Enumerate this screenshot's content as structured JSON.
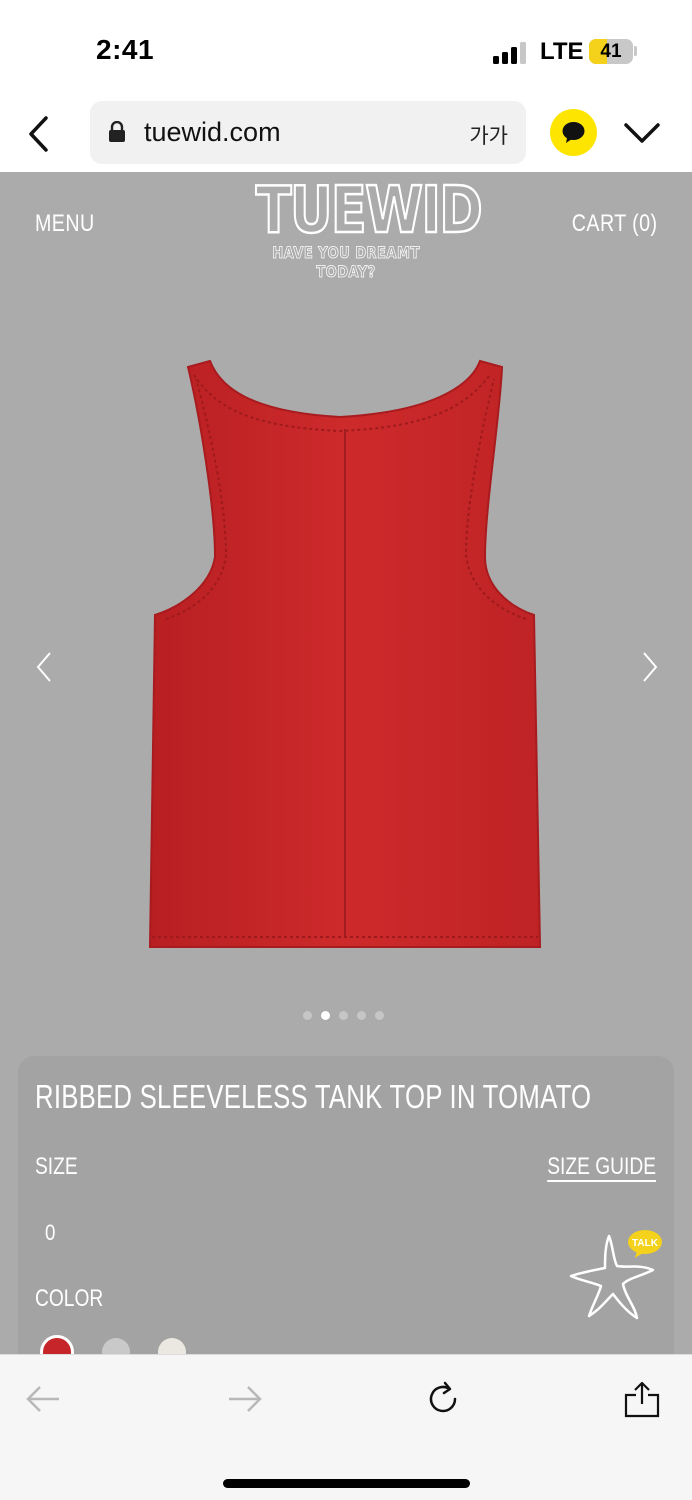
{
  "status_bar": {
    "time": "2:41",
    "network": "LTE",
    "battery_level": "41",
    "battery_fraction": 0.41,
    "signal_bars_active": 3,
    "signal_bars_total": 4
  },
  "browser": {
    "url": "tuewid.com",
    "font_size_button": "가가",
    "icons": {
      "back": "chevron-left-icon",
      "lock": "lock-icon",
      "kakao": "kakao-chat-icon",
      "more": "chevron-down-icon"
    }
  },
  "site_header": {
    "menu_label": "MENU",
    "cart_label": "CART (0)",
    "logo_text": "TUEWID",
    "logo_tagline": "HAVE YOU DREAMT TODAY?"
  },
  "gallery": {
    "image_alt": "red ribbed sleeveless tank top",
    "slide_count": 5,
    "active_slide": 2
  },
  "product": {
    "title": "RIBBED SLEEVELESS TANK TOP IN TOMATO",
    "size_label": "SIZE",
    "size_guide_label": "SIZE GUIDE",
    "size_options": [
      "0"
    ],
    "color_label": "COLOR",
    "color_swatches": [
      {
        "name": "tomato",
        "color": "#c6262a",
        "selected": true
      },
      {
        "name": "gray",
        "color": "#c9c9c9",
        "selected": false
      },
      {
        "name": "cream",
        "color": "#eae8e0",
        "selected": false
      }
    ]
  },
  "talk_widget": {
    "label": "TALK"
  },
  "colors": {
    "page_background": "#ababab",
    "card_background": "#a3a3a3",
    "kakao_yellow": "#fee500",
    "product_red": "#c6262a"
  }
}
